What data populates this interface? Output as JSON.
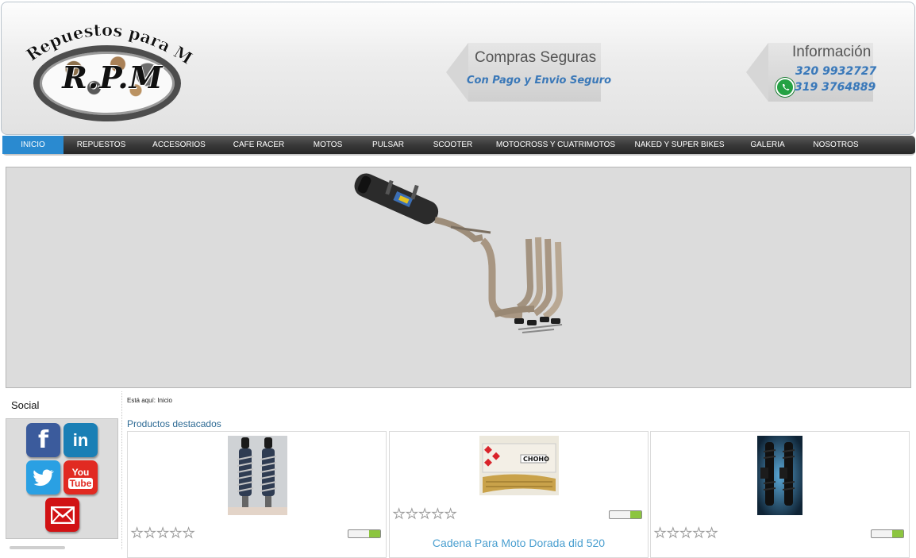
{
  "header": {
    "logo_text": "Repuestos para Motos",
    "logo_mark": "R.P.M",
    "compras_title": "Compras Seguras",
    "compras_sub": "Con Pago y Envio Seguro",
    "info_title": "Información",
    "phone1": "320 9932727",
    "phone2": "319 3764889"
  },
  "nav": {
    "items": [
      "INICIO",
      "REPUESTOS",
      "ACCESORIOS",
      "CAFE RACER",
      "MOTOS",
      "PULSAR",
      "SCOOTER",
      "MOTOCROSS Y CUATRIMOTOS",
      "NAKED Y SUPER BIKES",
      "GALERIA",
      "NOSOTROS"
    ],
    "active": "INICIO"
  },
  "sidebar": {
    "social_title": "Social",
    "icons": [
      "facebook-icon",
      "linkedin-icon",
      "twitter-icon",
      "youtube-icon",
      "email-icon"
    ],
    "youtube_line1": "You",
    "youtube_line2": "Tube",
    "linkedin_text": "in",
    "facebook_text": "f"
  },
  "main": {
    "breadcrumb": "Está aquí: Inicio",
    "section_title": "Productos destacados",
    "products": [
      {
        "name": "",
        "rating": 0
      },
      {
        "name": "Cadena Para Moto Dorada did 520",
        "rating": 0
      },
      {
        "name": "",
        "rating": 0
      }
    ]
  },
  "colors": {
    "nav_active": "#2a8ad0",
    "link": "#4a9fd0",
    "section_title": "#2d6a94",
    "whatsapp": "#25a244",
    "facebook": "#3b5b9c",
    "linkedin": "#1a7fb5",
    "twitter": "#2aa0e3",
    "youtube": "#e12a22",
    "email": "#d11214"
  }
}
